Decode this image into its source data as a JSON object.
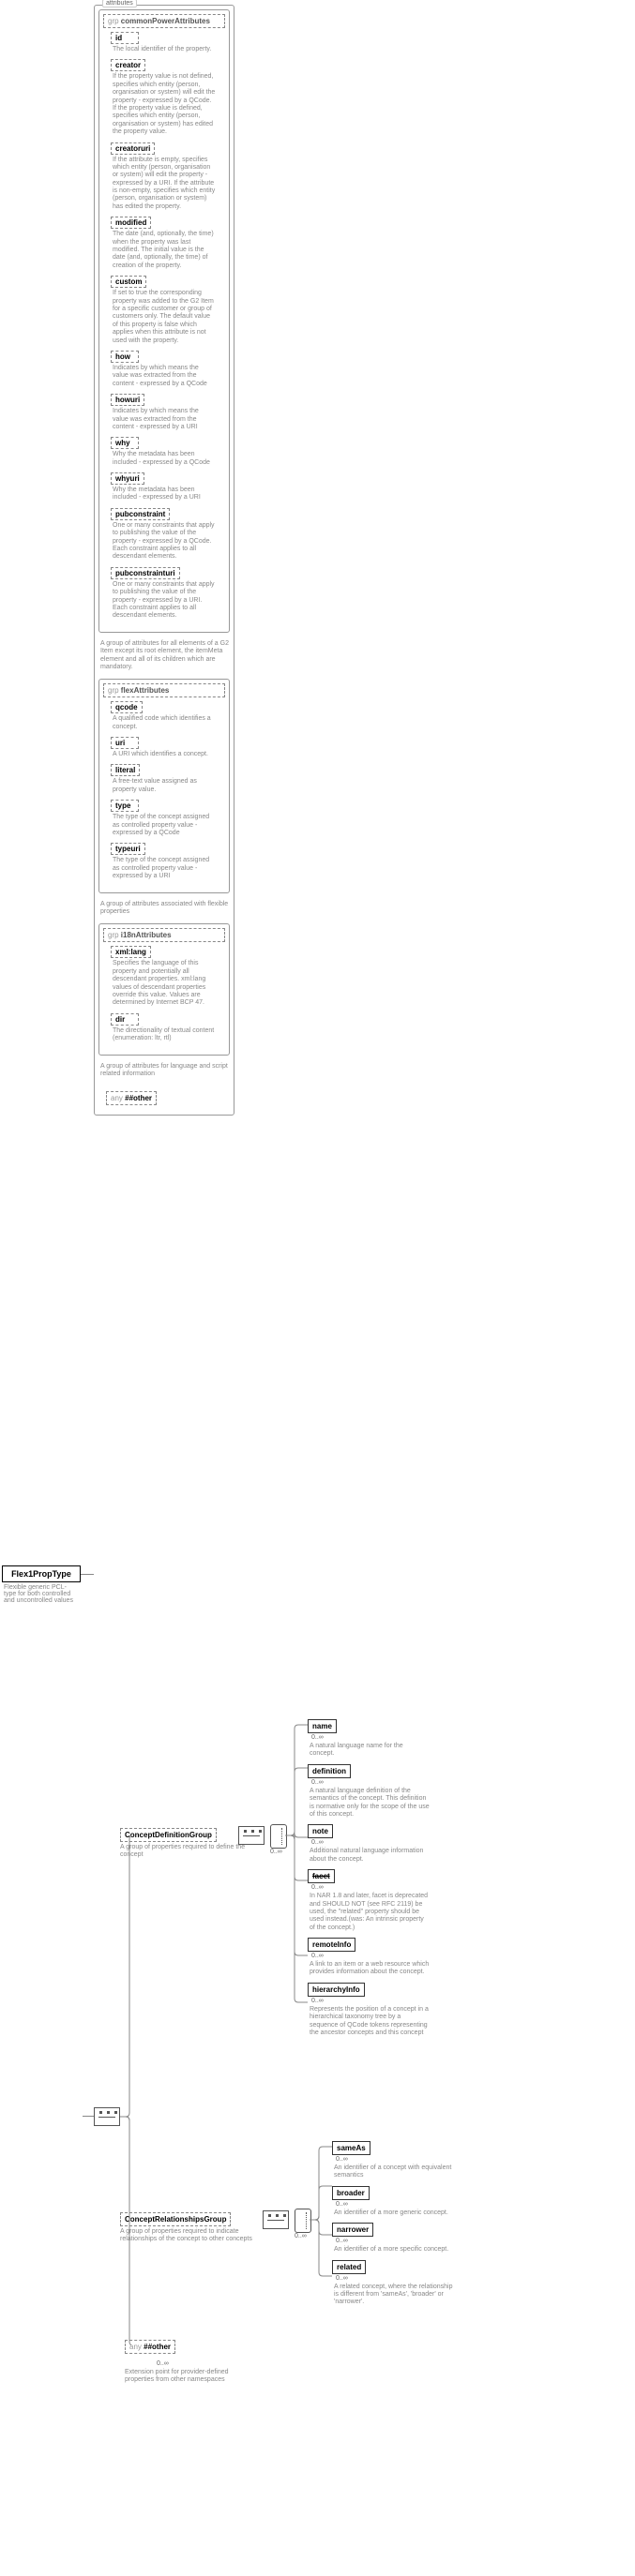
{
  "root": {
    "name": "Flex1PropType",
    "desc": "Flexible generic PCL-type for both controlled and uncontrolled values"
  },
  "attr_tab": "attributes",
  "groups": {
    "grp1": {
      "kw": "grp ",
      "title": "commonPowerAttributes",
      "items": [
        {
          "t": "id",
          "d": "The local identifier of the property."
        },
        {
          "t": "creator",
          "d": "If the property value is not defined, specifies which entity (person, organisation or system) will edit the property - expressed by a QCode. If the property value is defined, specifies which entity (person, organisation or system) has edited the property value."
        },
        {
          "t": "creatoruri",
          "d": "If the attribute is empty, specifies which entity (person, organisation or system) will edit the property - expressed by a URI. If the attribute is non-empty, specifies which entity (person, organisation or system) has edited the property."
        },
        {
          "t": "modified",
          "d": "The date (and, optionally, the time) when the property was last modified. The initial value is the date (and, optionally, the time) of creation of the property."
        },
        {
          "t": "custom",
          "d": "If set to true the corresponding property was added to the G2 Item for a specific customer or group of customers only. The default value of this property is false which applies when this attribute is not used with the property."
        },
        {
          "t": "how",
          "d": "Indicates by which means the value was extracted from the content - expressed by a QCode"
        },
        {
          "t": "howuri",
          "d": "Indicates by which means the value was extracted from the content - expressed by a URI"
        },
        {
          "t": "why",
          "d": "Why the metadata has been included - expressed by a QCode"
        },
        {
          "t": "whyuri",
          "d": "Why the metadata has been included - expressed by a URI"
        },
        {
          "t": "pubconstraint",
          "d": "One or many constraints that apply to publishing the value of the property - expressed by a QCode. Each constraint applies to all descendant elements."
        },
        {
          "t": "pubconstrainturi",
          "d": "One or many constraints that apply to publishing the value of the property - expressed by a URI. Each constraint applies to all descendant elements."
        }
      ],
      "desc": "A group of attributes for all elements of a G2 Item except its root element, the itemMeta element and all of its children which are mandatory."
    },
    "grp2": {
      "kw": "grp ",
      "title": "flexAttributes",
      "items": [
        {
          "t": "qcode",
          "d": "A qualified code which identifies a concept."
        },
        {
          "t": "uri",
          "d": "A URI which identifies a concept."
        },
        {
          "t": "literal",
          "d": "A free-text value assigned as property value."
        },
        {
          "t": "type",
          "d": "The type of the concept assigned as controlled property value - expressed by a QCode"
        },
        {
          "t": "typeuri",
          "d": "The type of the concept assigned as controlled property value - expressed by a URI"
        }
      ],
      "desc": "A group of attributes associated with flexible properties"
    },
    "grp3": {
      "kw": "grp ",
      "title": "i18nAttributes",
      "items": [
        {
          "t": "xml:lang",
          "d": "Specifies the language of this property and potentially all descendant properties. xml:lang values of descendant properties override this value. Values are determined by Internet BCP 47."
        },
        {
          "t": "dir",
          "d": "The directionality of textual content (enumeration: ltr, rtl)"
        }
      ],
      "desc": "A group of attributes for language and script related information"
    }
  },
  "any1": {
    "kw": "any ",
    "label": "##other"
  },
  "lower": {
    "cdg": {
      "t": "ConceptDefinitionGroup",
      "d": "A group of properties required to define the concept"
    },
    "crg": {
      "t": "ConceptRelationshipsGroup",
      "d": "A group of properties required to indicate relationships of the concept to other concepts"
    },
    "any": {
      "kw": "any ",
      "label": "##other",
      "card": "0..∞",
      "d": "Extension point for provider-defined properties from other namespaces"
    }
  },
  "cdg_children": [
    {
      "t": "name",
      "d": "A natural language name for the concept."
    },
    {
      "t": "definition",
      "d": "A natural language definition of the semantics of the concept. This definition is normative only for the scope of the use of this concept."
    },
    {
      "t": "note",
      "d": "Additional natural language information about the concept."
    },
    {
      "t": "facet",
      "strike": true,
      "d": "In NAR 1.8 and later, facet is deprecated and SHOULD NOT (see RFC 2119) be used, the \"related\" property should be used instead.(was: An intrinsic property of the concept.)"
    },
    {
      "t": "remoteInfo",
      "d": "A link to an item or a web resource which provides information about the concept."
    },
    {
      "t": "hierarchyInfo",
      "d": "Represents the position of a concept in a hierarchical taxonomy tree by a sequence of QCode tokens representing the ancestor concepts and this concept"
    }
  ],
  "crg_children": [
    {
      "t": "sameAs",
      "d": "An identifier of a concept with equivalent semantics"
    },
    {
      "t": "broader",
      "d": "An identifier of a more generic concept."
    },
    {
      "t": "narrower",
      "d": "An identifier of a more specific concept."
    },
    {
      "t": "related",
      "d": "A related concept, where the relationship is different from 'sameAs', 'broader' or 'narrower'."
    }
  ],
  "card_inf": "0..∞"
}
